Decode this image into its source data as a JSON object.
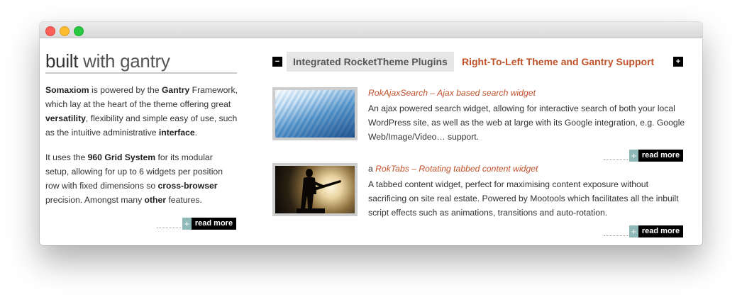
{
  "window": {
    "controls": [
      "close",
      "minimize",
      "zoom"
    ]
  },
  "left": {
    "heading_part1": "built",
    "heading_part2": " with gantry",
    "para1": [
      {
        "t": "Somaxiom",
        "b": true
      },
      {
        "t": " is powered by the ",
        "b": false
      },
      {
        "t": "Gantry",
        "b": true
      },
      {
        "t": " Framework, which lay at the heart of the theme offering great ",
        "b": false
      },
      {
        "t": "versatility",
        "b": true
      },
      {
        "t": ", flexibility and simple easy of use, such as the intuitive administrative ",
        "b": false
      },
      {
        "t": "interface",
        "b": true
      },
      {
        "t": ".",
        "b": false
      }
    ],
    "para2": [
      {
        "t": "It uses the ",
        "b": false
      },
      {
        "t": "960 Grid System",
        "b": true
      },
      {
        "t": " for its modular setup, allowing for up to 6 widgets per position row with fixed dimensions so ",
        "b": false
      },
      {
        "t": "cross-browser",
        "b": true
      },
      {
        "t": " precision. Amongst many ",
        "b": false
      },
      {
        "t": "other",
        "b": true
      },
      {
        "t": " features.",
        "b": false
      }
    ],
    "readmore_plus": "+",
    "readmore_label": "read more"
  },
  "tabs": {
    "prev_symbol": "−",
    "next_symbol": "+",
    "tab1": "Integrated RocketTheme Plugins",
    "tab2": "Right-To-Left Theme and Gantry Support"
  },
  "items": [
    {
      "prefix": "",
      "title": "RokAjaxSearch – Ajax based search widget",
      "body": "An ajax powered search widget, allowing for interactive search of both your local WordPress site, as well as the web at large with its Google integration, e.g. Google Web/Image/Video… support.",
      "readmore_plus": "+",
      "readmore_label": "read more"
    },
    {
      "prefix": "a ",
      "title": "RokTabs – Rotating tabbed content widget",
      "body": "A tabbed content widget, perfect for maximising content exposure without sacrificing on site real estate. Powered by Mootools which facilitates all the inbuilt script effects such as animations, transitions and auto-rotation.",
      "readmore_plus": "+",
      "readmore_label": "read more"
    }
  ],
  "colors": {
    "accent": "#c0522a",
    "readmore_plus_bg": "#8fb9b9",
    "readmore_bg": "#000000",
    "tab_active_bg": "#e6e6e6"
  }
}
